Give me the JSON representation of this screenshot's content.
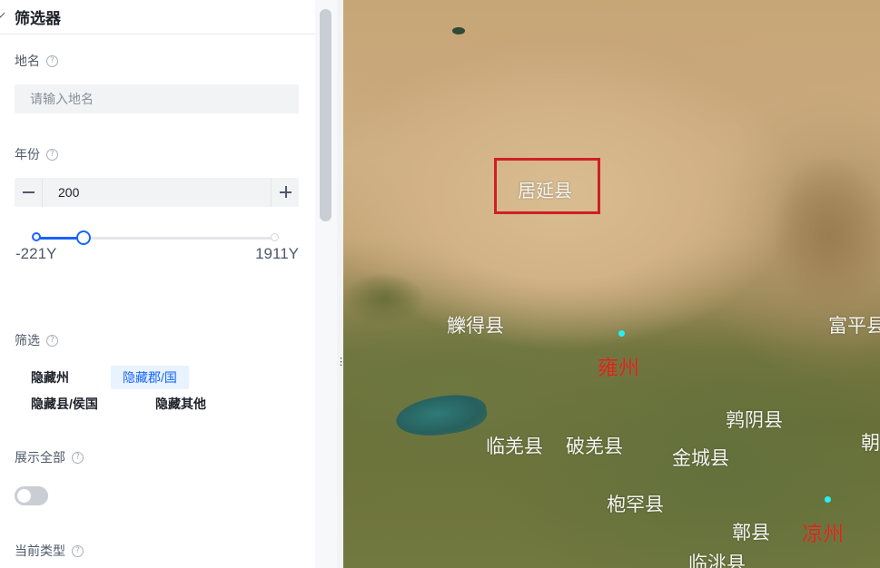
{
  "sidebar": {
    "header": {
      "title": "筛选器"
    },
    "place_name": {
      "label": "地名",
      "placeholder": "请输入地名",
      "value": ""
    },
    "year": {
      "label": "年份",
      "value": "200",
      "min_label": "-221Y",
      "max_label": "1911Y",
      "range": [
        -221,
        1911
      ],
      "selected": [
        -221,
        200
      ]
    },
    "filter": {
      "label": "筛选",
      "options": [
        "隐藏州",
        "隐藏郡/国",
        "隐藏县/侯国",
        "隐藏其他"
      ],
      "active": "隐藏郡/国"
    },
    "show_all": {
      "label": "展示全部",
      "enabled": false
    },
    "current_type": {
      "label": "当前类型"
    }
  },
  "map": {
    "labels": {
      "juyan": "居延县",
      "ledei": "觻得县",
      "yongzhou": "雍州",
      "fuping": "富平县",
      "chunyin": "鹑阴县",
      "linqiang": "临羌县",
      "poqiang": "破羌县",
      "jincheng": "金城县",
      "fuhan": "枹罕县",
      "zhao": "朝",
      "gui": "鄣县",
      "liangzhou": "凉州",
      "lintao": "临洮县"
    },
    "highlighted": "居延县",
    "colors": {
      "state_label": "#d8261a",
      "highlight_box": "#cf1f26",
      "marker": "#27f0f0"
    }
  }
}
